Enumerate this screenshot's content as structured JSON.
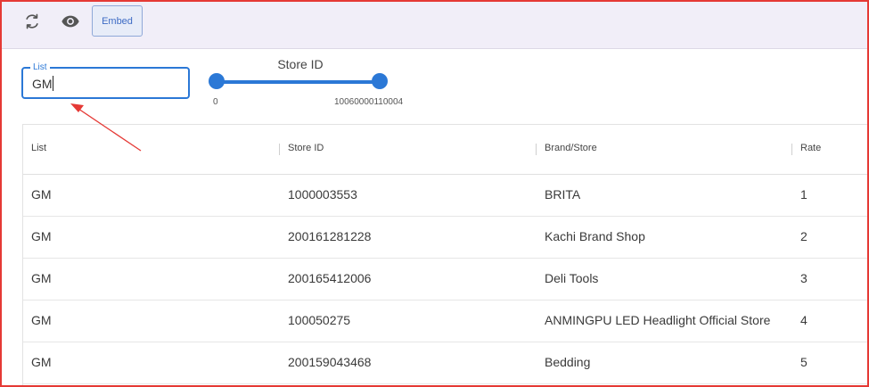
{
  "toolbar": {
    "refresh_icon": "refresh-icon",
    "view_icon": "eye-icon",
    "embed_label": "Embed"
  },
  "filter": {
    "list_label": "List",
    "list_value": "GM"
  },
  "slider": {
    "title": "Store ID",
    "min_label": "0",
    "max_label": "10060000110004"
  },
  "table": {
    "headers": [
      "List",
      "Store ID",
      "Brand/Store",
      "Rate"
    ],
    "rows": [
      [
        "GM",
        "1000003553",
        "BRITA",
        "1"
      ],
      [
        "GM",
        "200161281228",
        "Kachi Brand Shop",
        "2"
      ],
      [
        "GM",
        "200165412006",
        "Deli Tools",
        "3"
      ],
      [
        "GM",
        "100050275",
        "ANMINGPU LED Headlight Official Store",
        "4"
      ],
      [
        "GM",
        "200159043468",
        "Bedding",
        "5"
      ]
    ]
  },
  "colors": {
    "accent": "#2b78d6",
    "annotation": "#e53935",
    "toolbar_bg": "#f1eef8"
  }
}
